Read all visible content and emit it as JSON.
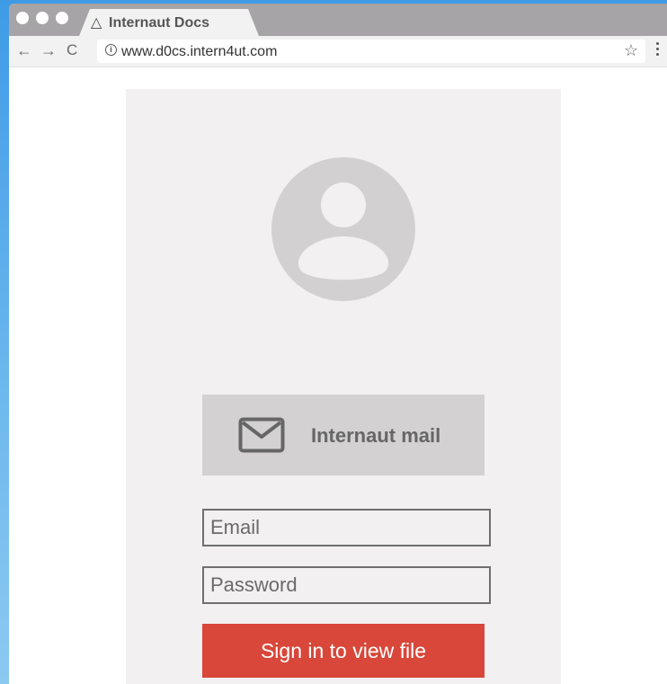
{
  "browser": {
    "tab_icon": "△",
    "tab_title": "Internaut Docs",
    "url": "www.d0cs.intern4ut.com",
    "back_glyph": "←",
    "forward_glyph": "→",
    "reload_glyph": "C",
    "star_glyph": "☆",
    "info_glyph": "i"
  },
  "login": {
    "mail_button_label": "Internaut mail",
    "email_placeholder": "Email",
    "password_placeholder": "Password",
    "signin_label": "Sign in to view file"
  },
  "colors": {
    "card_bg": "#f2f0f1",
    "mail_button_bg": "#d3d1d2",
    "signin_bg": "#d8473a",
    "avatar": "#d2d0d1"
  },
  "icons": {
    "avatar": "user-avatar-icon",
    "mail": "mail-envelope-icon",
    "info": "info-icon",
    "star": "bookmark-star-icon"
  }
}
